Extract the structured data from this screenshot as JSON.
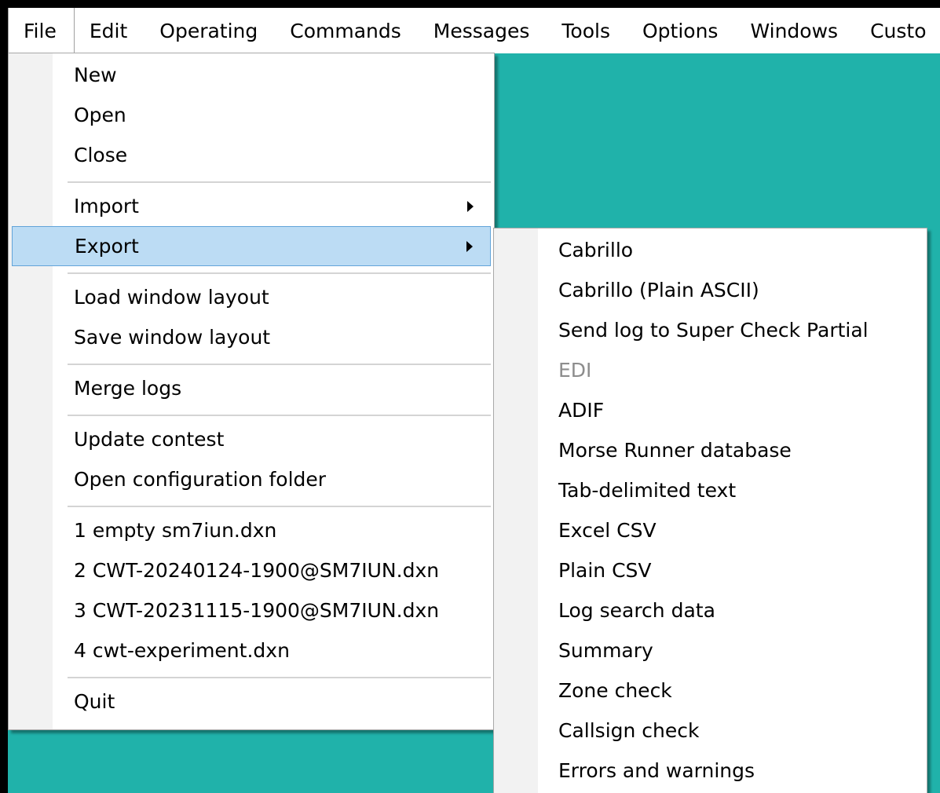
{
  "menubar": {
    "items": [
      "File",
      "Edit",
      "Operating",
      "Commands",
      "Messages",
      "Tools",
      "Options",
      "Windows",
      "Custo"
    ]
  },
  "file_menu": {
    "new": "New",
    "open": "Open",
    "close": "Close",
    "import": "Import",
    "export": "Export",
    "load_layout": "Load window layout",
    "save_layout": "Save window layout",
    "merge_logs": "Merge logs",
    "update_contest": "Update contest",
    "open_config": "Open configuration folder",
    "recent": [
      "1 empty sm7iun.dxn",
      "2 CWT-20240124-1900@SM7IUN.dxn",
      "3 CWT-20231115-1900@SM7IUN.dxn",
      "4 cwt-experiment.dxn"
    ],
    "quit": "Quit"
  },
  "export_menu": {
    "items": [
      "Cabrillo",
      "Cabrillo (Plain ASCII)",
      "Send log to Super Check Partial",
      "EDI",
      "ADIF",
      "Morse Runner database",
      "Tab-delimited text",
      "Excel CSV",
      "Plain CSV",
      "Log search data",
      "Summary",
      "Zone check",
      "Callsign check",
      "Errors and warnings"
    ],
    "disabled_item": "EDI"
  },
  "colors": {
    "background": "#20B2AA",
    "highlight": "#BCDCF4",
    "highlight_border": "#62A4D9"
  }
}
